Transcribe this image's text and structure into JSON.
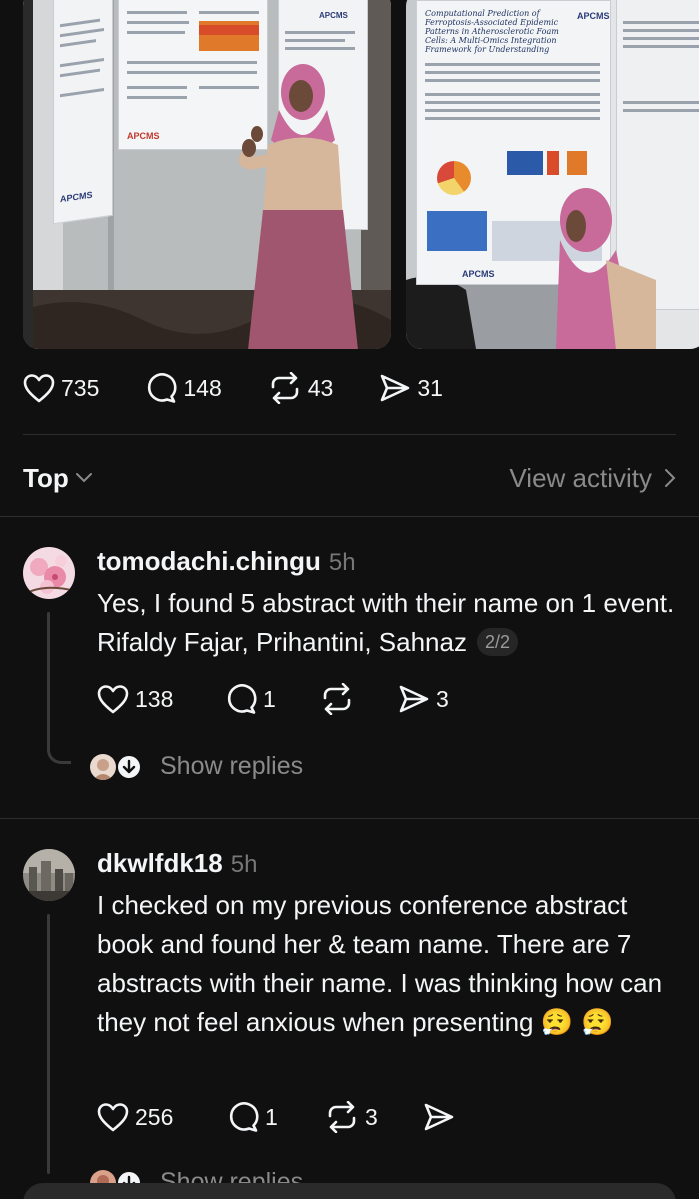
{
  "post": {
    "likes": "735",
    "comments": "148",
    "reposts": "43",
    "shares": "31"
  },
  "media": {
    "photo1_brand": "APCMS",
    "photo2_brand": "APCMS",
    "photo2_poster_title": "Computational Prediction of Ferroptosis-Associated Epidemic Patterns in Atherosclerotic Foam Cells: A Multi-Omics Integration Framework for Understanding Plaque Vulnerability"
  },
  "sort": {
    "label": "Top",
    "view_activity": "View activity"
  },
  "comments": [
    {
      "username": "tomodachi.chingu",
      "time": "5h",
      "text": "Yes, I found 5 abstract with their name on 1 event. Rifaldy Fajar, Prihantini, Sahnaz",
      "pager": "2/2",
      "likes": "138",
      "replies": "1",
      "reposts": "",
      "shares": "3",
      "show_replies": "Show replies"
    },
    {
      "username": "dkwlfdk18",
      "time": "5h",
      "text": "I checked on my previous conference abstract book and found her & team name. There are 7 abstracts with their name. I was thinking how can they not feel anxious when presenting",
      "emoji": "😮‍💨 😮‍💨",
      "likes": "256",
      "replies": "1",
      "reposts": "3",
      "shares": "",
      "show_replies": "Show replies"
    }
  ],
  "icons": {
    "like": "heart-icon",
    "reply": "speech-bubble-icon",
    "repost": "repost-arrows-icon",
    "share": "paper-plane-icon",
    "sort_chevron": "chevron-down-icon",
    "activity_chevron": "chevron-right-icon"
  },
  "colors": {
    "background": "#101010",
    "text": "#f3f5f7",
    "muted": "#8a8a8a",
    "divider": "#2d2d2d",
    "hijab": "#c86a9a"
  }
}
